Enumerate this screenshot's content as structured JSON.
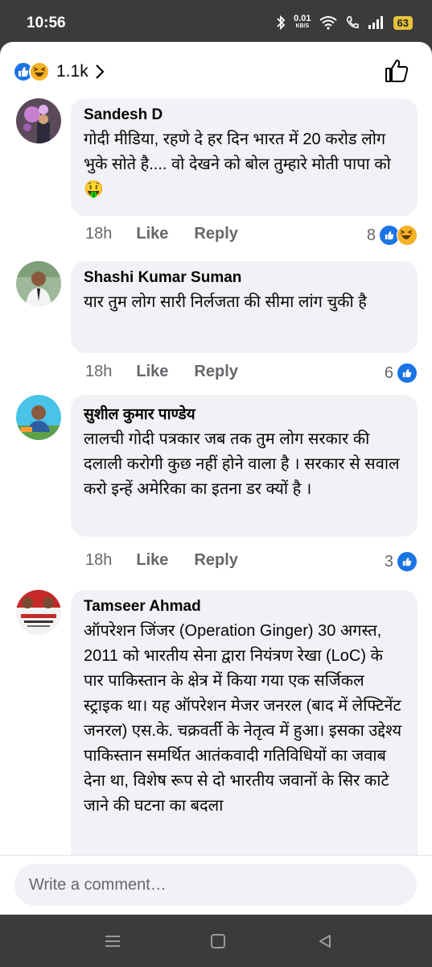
{
  "status_bar": {
    "time": "10:56",
    "net_speed": "0.01",
    "net_unit": "KB/S",
    "battery": "63"
  },
  "header": {
    "reaction_count": "1.1k",
    "reaction_icons": [
      "like-icon",
      "haha-icon"
    ]
  },
  "comments": [
    {
      "author": "Sandesh D",
      "text": "गोदी मीडिया, रहणे दे हर दिन भारत में 20 करोड लोग भुके सोते है.... वो देखने को बोल तुम्हारे मोती पापा को 🤑",
      "time": "18h",
      "like_label": "Like",
      "reply_label": "Reply",
      "reaction_count": "8",
      "reaction_icons": [
        "like-icon",
        "haha-icon"
      ]
    },
    {
      "author": "Shashi Kumar Suman",
      "text": "यार तुम लोग सारी निर्लजता की सीमा लांग चुकी है",
      "time": "18h",
      "like_label": "Like",
      "reply_label": "Reply",
      "reaction_count": "6",
      "reaction_icons": [
        "like-icon"
      ]
    },
    {
      "author": "सुशील कुमार पाण्डेय",
      "text": "लालची गोदी पत्रकार जब तक तुम लोग सरकार की दलाली करोगी कुछ नहीं होने वाला है । सरकार से सवाल करो इन्हें अमेरिका का इतना डर क्यों है ।",
      "time": "18h",
      "like_label": "Like",
      "reply_label": "Reply",
      "reaction_count": "3",
      "reaction_icons": [
        "like-icon"
      ]
    },
    {
      "author": "Tamseer Ahmad",
      "text": "ऑपरेशन जिंजर (Operation Ginger) 30 अगस्त, 2011 को भारतीय सेना द्वारा नियंत्रण रेखा (LoC) के पार पाकिस्तान के क्षेत्र में किया गया एक सर्जिकल स्ट्राइक था। यह ऑपरेशन मेजर जनरल (बाद में लेफ्टिनेंट जनरल) एस.के. चक्रवर्ती के नेतृत्व में हुआ। इसका उद्देश्य पाकिस्तान समर्थित आतंकवादी गतिविधियों का जवाब देना था, विशेष रूप से दो भारतीय जवानों के सिर काटे जाने की घटना का बदला"
    }
  ],
  "composer": {
    "placeholder": "Write a comment…"
  },
  "colors": {
    "facebook_blue": "#1b74e4",
    "bubble_bg": "#f0f2f5",
    "secondary_text": "#65676b",
    "battery": "#e6c23a"
  }
}
